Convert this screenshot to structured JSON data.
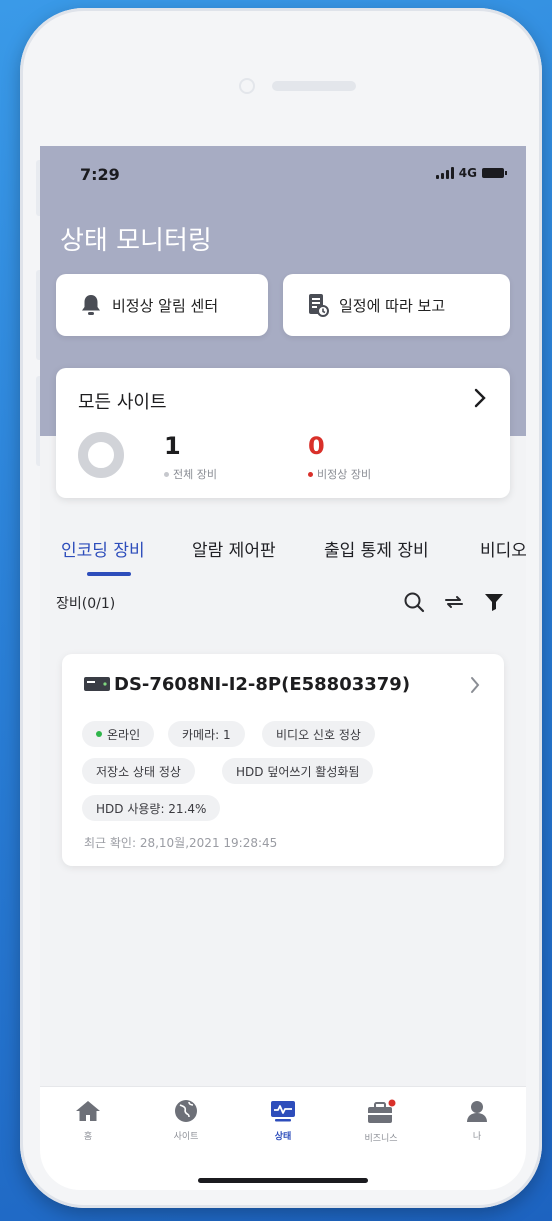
{
  "status_bar": {
    "time": "7:29",
    "network": "4G"
  },
  "header": {
    "title": "상태 모니터링"
  },
  "quick_actions": [
    {
      "label": "비정상  알림 센터",
      "icon": "bell-icon"
    },
    {
      "label": "일정에 따라 보고",
      "icon": "report-icon"
    }
  ],
  "site_card": {
    "title": "모든 사이트",
    "total_value": "1",
    "total_label": "전체 장비",
    "abnormal_value": "0",
    "abnormal_label": "비정상 장비"
  },
  "tabs": [
    {
      "label": "인코딩 장비",
      "active": true
    },
    {
      "label": "알람 제어판",
      "active": false
    },
    {
      "label": "출입 통제 장비",
      "active": false
    },
    {
      "label": "비디오",
      "active": false
    }
  ],
  "list": {
    "count_label": "장비(0/1)"
  },
  "device": {
    "name": "DS-7608NI-I2-8P(E58803379)",
    "chips": {
      "online": "온라인",
      "camera": "카메라: 1",
      "video_signal": "비디오 신호 정상",
      "storage": "저장소 상태 정상",
      "hdd_overwrite": "HDD 덮어쓰기 활성화됨",
      "hdd_usage": "HDD 사용량: 21.4%"
    },
    "last_check": "최근 확인: 28,10월,2021 19:28:45"
  },
  "bottom_nav": [
    {
      "label": "홈",
      "icon": "home-icon",
      "active": false
    },
    {
      "label": "사이트",
      "icon": "globe-icon",
      "active": false
    },
    {
      "label": "상태",
      "icon": "monitor-icon",
      "active": true
    },
    {
      "label": "비즈니스",
      "icon": "briefcase-icon",
      "active": false
    },
    {
      "label": "나",
      "icon": "user-icon",
      "active": false
    }
  ],
  "colors": {
    "accent": "#2d4dbb",
    "header": "#a7acc3",
    "online": "#2fb54a",
    "abnormal": "#d9302a"
  }
}
